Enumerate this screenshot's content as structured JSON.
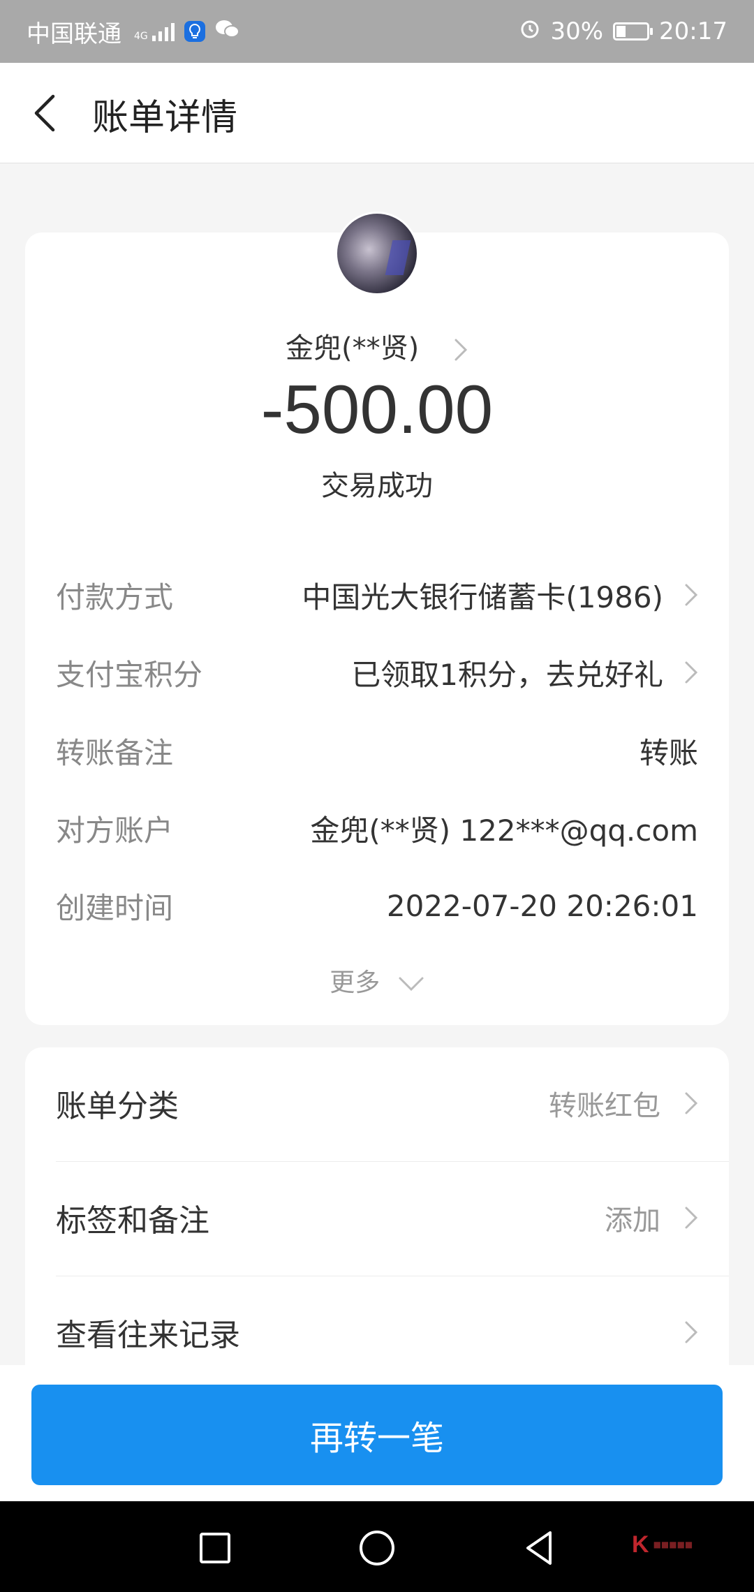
{
  "status_bar": {
    "carrier": "中国联通",
    "network": "4G",
    "battery_percent": "30%",
    "battery_level": 0.3,
    "time": "20:17",
    "icons": [
      "signal-icon",
      "assistant-app-icon",
      "wechat-icon",
      "alarm-icon",
      "battery-icon"
    ]
  },
  "header": {
    "back_icon": "chevron-left-icon",
    "title": "账单详情"
  },
  "summary": {
    "payee": "金兜(**贤)",
    "amount": "-500.00",
    "status": "交易成功"
  },
  "details": [
    {
      "label": "付款方式",
      "value": "中国光大银行储蓄卡(1986)",
      "has_chevron": true
    },
    {
      "label": "支付宝积分",
      "value": "已领取1积分，去兑好礼",
      "has_chevron": true
    },
    {
      "label": "转账备注",
      "value": "转账",
      "has_chevron": false
    },
    {
      "label": "对方账户",
      "value": "金兜(**贤) 122***@qq.com",
      "has_chevron": false
    },
    {
      "label": "创建时间",
      "value": "2022-07-20 20:26:01",
      "has_chevron": false
    }
  ],
  "more_label": "更多",
  "options": [
    {
      "label": "账单分类",
      "value": "转账红包"
    },
    {
      "label": "标签和备注",
      "value": "添加"
    },
    {
      "label": "查看往来记录",
      "value": ""
    }
  ],
  "action_button": "再转一笔",
  "nav_bar": {
    "icons": [
      "recent-apps-square-icon",
      "home-circle-icon",
      "back-triangle-icon"
    ]
  },
  "colors": {
    "primary": "#1890f0",
    "status_bar_bg": "#a9a9a9",
    "page_bg": "#f5f5f5",
    "label_gray": "#888888"
  }
}
